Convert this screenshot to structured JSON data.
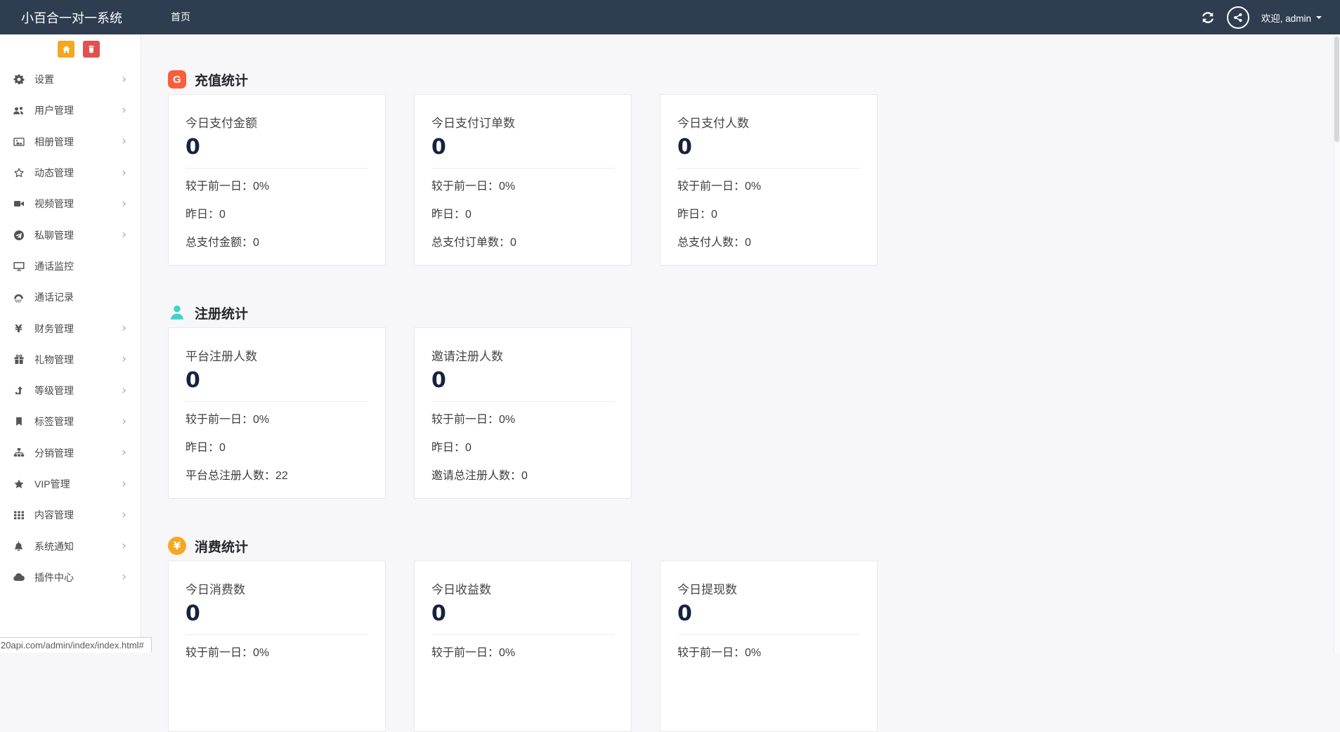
{
  "topbar": {
    "brand": "小百合一对一系统",
    "nav_home": "首页",
    "welcome": "欢迎, admin",
    "icons": [
      "refresh-icon",
      "avatar-share-icon",
      "caret-down-icon"
    ]
  },
  "sidebar": {
    "action_icons": [
      "home-icon",
      "trash-icon"
    ],
    "items": [
      {
        "label": "设置",
        "icon": "gears-icon",
        "chevron": true
      },
      {
        "label": "用户管理",
        "icon": "users-icon",
        "chevron": true
      },
      {
        "label": "相册管理",
        "icon": "image-icon",
        "chevron": true
      },
      {
        "label": "动态管理",
        "icon": "star-outline-icon",
        "chevron": true
      },
      {
        "label": "视频管理",
        "icon": "video-icon",
        "chevron": true
      },
      {
        "label": "私聊管理",
        "icon": "telegram-icon",
        "chevron": true
      },
      {
        "label": "通话监控",
        "icon": "monitor-icon",
        "chevron": false
      },
      {
        "label": "通话记录",
        "icon": "call-record-icon",
        "chevron": false
      },
      {
        "label": "财务管理",
        "icon": "yen-icon",
        "chevron": true
      },
      {
        "label": "礼物管理",
        "icon": "gift-icon",
        "chevron": true
      },
      {
        "label": "等级管理",
        "icon": "level-up-icon",
        "chevron": true
      },
      {
        "label": "标签管理",
        "icon": "bookmark-icon",
        "chevron": true
      },
      {
        "label": "分销管理",
        "icon": "sitemap-icon",
        "chevron": true
      },
      {
        "label": "VIP管理",
        "icon": "star-icon",
        "chevron": true
      },
      {
        "label": "内容管理",
        "icon": "grid-icon",
        "chevron": true
      },
      {
        "label": "系统通知",
        "icon": "bell-icon",
        "chevron": true
      },
      {
        "label": "插件中心",
        "icon": "cloud-icon",
        "chevron": true
      }
    ]
  },
  "sections": [
    {
      "title": "充值统计",
      "icon": "wallet-icon",
      "icon_glyph": "G",
      "accent": "#f95e3b",
      "cards": [
        {
          "label": "今日支付金额",
          "value": "0",
          "rows": [
            "较于前一日：0%",
            "昨日：0",
            "总支付金额：0"
          ]
        },
        {
          "label": "今日支付订单数",
          "value": "0",
          "rows": [
            "较于前一日：0%",
            "昨日：0",
            "总支付订单数：0"
          ]
        },
        {
          "label": "今日支付人数",
          "value": "0",
          "rows": [
            "较于前一日：0%",
            "昨日：0",
            "总支付人数：0"
          ]
        }
      ]
    },
    {
      "title": "注册统计",
      "icon": "person-icon",
      "accent": "#3ed3cd",
      "cards": [
        {
          "label": "平台注册人数",
          "value": "0",
          "rows": [
            "较于前一日：0%",
            "昨日：0",
            "平台总注册人数：22"
          ]
        },
        {
          "label": "邀请注册人数",
          "value": "0",
          "rows": [
            "较于前一日：0%",
            "昨日：0",
            "邀请总注册人数：0"
          ]
        }
      ]
    },
    {
      "title": "消费统计",
      "icon": "yen-circle-icon",
      "icon_glyph": "¥",
      "accent": "#f7a723",
      "cards": [
        {
          "label": "今日消费数",
          "value": "0",
          "rows": [
            "较于前一日：0%"
          ]
        },
        {
          "label": "今日收益数",
          "value": "0",
          "rows": [
            "较于前一日：0%"
          ]
        },
        {
          "label": "今日提现数",
          "value": "0",
          "rows": [
            "较于前一日：0%"
          ]
        }
      ]
    }
  ],
  "statusbar": {
    "text": "20api.com/admin/index/index.html#"
  },
  "colors": {
    "topbar_bg": "#2e3d4f",
    "sidebar_bg": "#ffffff",
    "main_bg": "#f7f7f9",
    "home_button": "#f5a623",
    "trash_button": "#e25050",
    "recharge_accent": "#f95e3b",
    "register_accent": "#3ed3cd",
    "consume_accent": "#f7a723",
    "value_text": "#17233d"
  }
}
